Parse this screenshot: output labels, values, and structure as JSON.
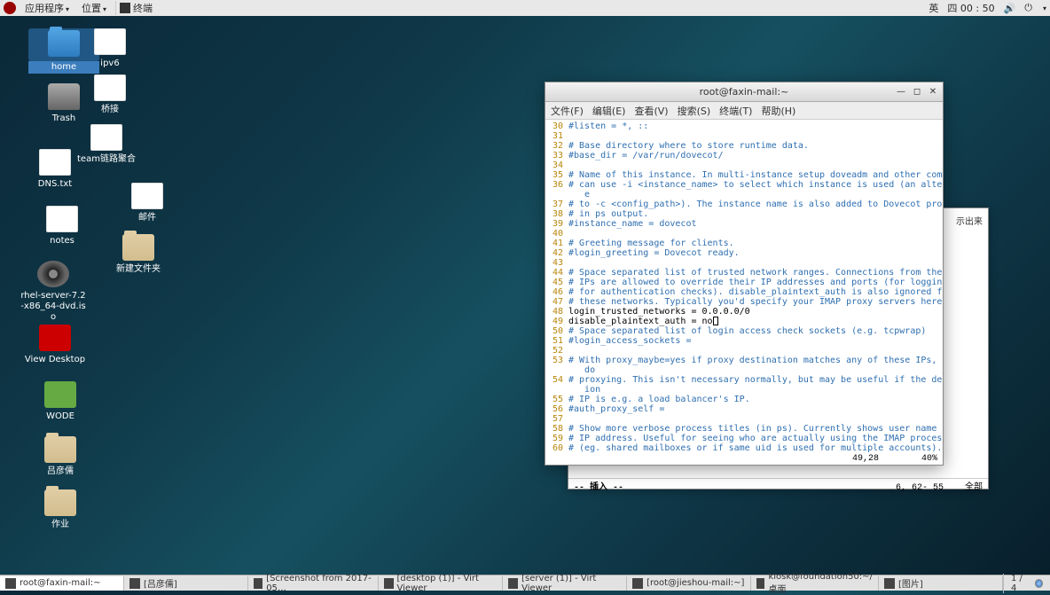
{
  "top_panel": {
    "menu_apps": "应用程序",
    "menu_places": "位置",
    "active_app": "终端",
    "ime": "英",
    "clock": "四 00 : 50"
  },
  "desktop_icons": {
    "home": "home",
    "ipv6": "ipv6",
    "bridge": "桥接",
    "trash": "Trash",
    "team": "team链路聚合",
    "dns": "DNS.txt",
    "mail": "邮件",
    "notes": "notes",
    "newfolder": "新建文件夹",
    "iso": "rhel-server-7.2-x86_64-dvd.iso",
    "viewdesktop": "View Desktop",
    "wode": "WODE",
    "lyr": "吕彦儒",
    "zuoye": "作业"
  },
  "terminal": {
    "title": "root@faxin-mail:~",
    "menu": {
      "file": "文件(F)",
      "edit": "编辑(E)",
      "view": "查看(V)",
      "search": "搜索(S)",
      "terminal": "终端(T)",
      "help": "帮助(H)"
    },
    "lines": [
      {
        "n": 30,
        "t": "#listen = *, ::",
        "c": true
      },
      {
        "n": 31,
        "t": "",
        "c": false
      },
      {
        "n": 32,
        "t": "# Base directory where to store runtime data.",
        "c": true
      },
      {
        "n": 33,
        "t": "#base_dir = /var/run/dovecot/",
        "c": true
      },
      {
        "n": 34,
        "t": "",
        "c": false
      },
      {
        "n": 35,
        "t": "# Name of this instance. In multi-instance setup doveadm and other commands",
        "c": true
      },
      {
        "n": 36,
        "t": "# can use -i <instance_name> to select which instance is used (an alternativ\n   e",
        "c": true
      },
      {
        "n": 37,
        "t": "# to -c <config_path>). The instance name is also added to Dovecot processes",
        "c": true
      },
      {
        "n": 38,
        "t": "# in ps output.",
        "c": true
      },
      {
        "n": 39,
        "t": "#instance_name = dovecot",
        "c": true
      },
      {
        "n": 40,
        "t": "",
        "c": false
      },
      {
        "n": 41,
        "t": "# Greeting message for clients.",
        "c": true
      },
      {
        "n": 42,
        "t": "#login_greeting = Dovecot ready.",
        "c": true
      },
      {
        "n": 43,
        "t": "",
        "c": false
      },
      {
        "n": 44,
        "t": "# Space separated list of trusted network ranges. Connections from these",
        "c": true
      },
      {
        "n": 45,
        "t": "# IPs are allowed to override their IP addresses and ports (for logging and",
        "c": true
      },
      {
        "n": 46,
        "t": "# for authentication checks). disable_plaintext_auth is also ignored for",
        "c": true
      },
      {
        "n": 47,
        "t": "# these networks. Typically you'd specify your IMAP proxy servers here.",
        "c": true
      },
      {
        "n": 48,
        "t": "login_trusted_networks = 0.0.0.0/0",
        "c": false
      },
      {
        "n": 49,
        "t": "disable_plaintext_auth = no",
        "c": false,
        "cursor": true
      },
      {
        "n": 50,
        "t": "# Space separated list of login access check sockets (e.g. tcpwrap)",
        "c": true
      },
      {
        "n": 51,
        "t": "#login_access_sockets =",
        "c": true
      },
      {
        "n": 52,
        "t": "",
        "c": false
      },
      {
        "n": 53,
        "t": "# With proxy_maybe=yes if proxy destination matches any of these IPs, don't\n   do",
        "c": true
      },
      {
        "n": 54,
        "t": "# proxying. This isn't necessary normally, but may be useful if the destinat\n   ion",
        "c": true
      },
      {
        "n": 55,
        "t": "# IP is e.g. a load balancer's IP.",
        "c": true
      },
      {
        "n": 56,
        "t": "#auth_proxy_self =",
        "c": true
      },
      {
        "n": 57,
        "t": "",
        "c": false
      },
      {
        "n": 58,
        "t": "# Show more verbose process titles (in ps). Currently shows user name and",
        "c": true
      },
      {
        "n": 59,
        "t": "# IP address. Useful for seeing who are actually using the IMAP processes",
        "c": true
      },
      {
        "n": 60,
        "t": "# (eg. shared mailboxes or if same uid is used for multiple accounts).",
        "c": true
      }
    ],
    "status_pos": "49,28",
    "status_pct": "40%"
  },
  "back_window": {
    "visible_text": "示出来",
    "mode": "-- 插入 --",
    "pos": "6, 62- 55",
    "pct": "全部"
  },
  "taskbar": {
    "items": [
      "root@faxin-mail:~",
      "[吕彦儒]",
      "[Screenshot from 2017-05…",
      "[desktop (1)] - Virt Viewer",
      "[server (1)] - Virt Viewer",
      "[root@jieshou-mail:~]",
      "kiosk@foundation50:~/桌面",
      "[图片]"
    ],
    "workspace": "1 / 4"
  }
}
